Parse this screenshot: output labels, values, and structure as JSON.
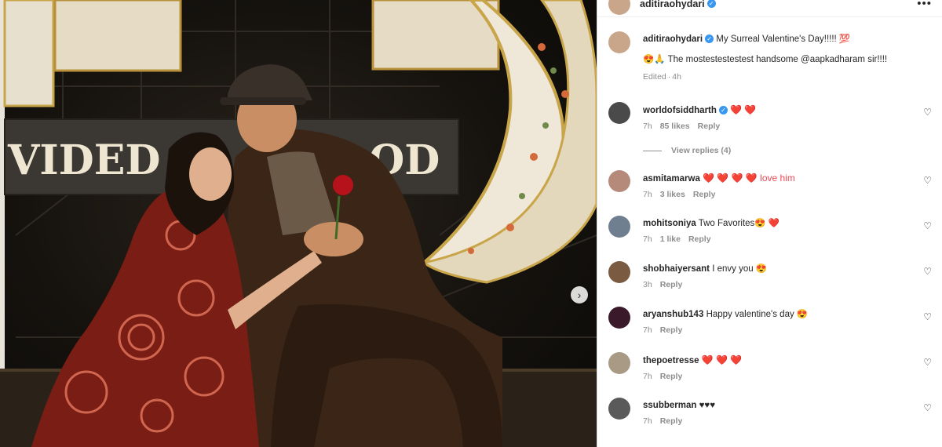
{
  "post": {
    "author": "aditiraohydari",
    "next_icon": "chevron-right-icon"
  },
  "caption": {
    "username": "aditiraohydari",
    "text_line1": "My Surreal Valentine's Day!!!!! 💯",
    "text_line2": "😍🙏 The mostestestestest handsome @aapkadharam sir!!!!",
    "edited": "Edited",
    "dot": "·",
    "time": "4h"
  },
  "comments": [
    {
      "username": "worldofsiddharth",
      "verified": true,
      "text": "❤️ ❤️",
      "time": "7h",
      "likes": "85 likes",
      "reply": "Reply",
      "avatar_color": "#4a4a4a"
    },
    {
      "username": "asmitamarwa",
      "verified": false,
      "text": "❤️ ❤️ ❤️ ❤️ love him",
      "time": "7h",
      "likes": "3 likes",
      "reply": "Reply",
      "avatar_color": "#b58a7a"
    },
    {
      "username": "mohitsoniya",
      "verified": false,
      "text": "Two Favorites😍 ❤️",
      "time": "7h",
      "likes": "1 like",
      "reply": "Reply",
      "avatar_color": "#6f7f8f"
    },
    {
      "username": "shobhaiyersant",
      "verified": false,
      "text": "I envy you 😍",
      "time": "3h",
      "likes": "",
      "reply": "Reply",
      "avatar_color": "#7a5a40"
    },
    {
      "username": "aryanshub143",
      "verified": false,
      "text": "Happy valentine's day 😍",
      "time": "7h",
      "likes": "",
      "reply": "Reply",
      "avatar_color": "#3a1a2a"
    },
    {
      "username": "thepoetresse",
      "verified": false,
      "text": "❤️ ❤️ ❤️",
      "time": "7h",
      "likes": "",
      "reply": "Reply",
      "avatar_color": "#a89a84"
    },
    {
      "username": "ssubberman",
      "verified": false,
      "text": "♥♥♥",
      "time": "7h",
      "likes": "",
      "reply": "Reply",
      "avatar_color": "#5a5a5a"
    }
  ],
  "view_replies": "View replies (4)",
  "icons": {
    "heart": "heart-outline-icon",
    "more": "more-options-icon"
  },
  "labels": {
    "more": "•••",
    "heart_glyph": "♡",
    "verified_glyph": "✓",
    "next_glyph": "›"
  }
}
